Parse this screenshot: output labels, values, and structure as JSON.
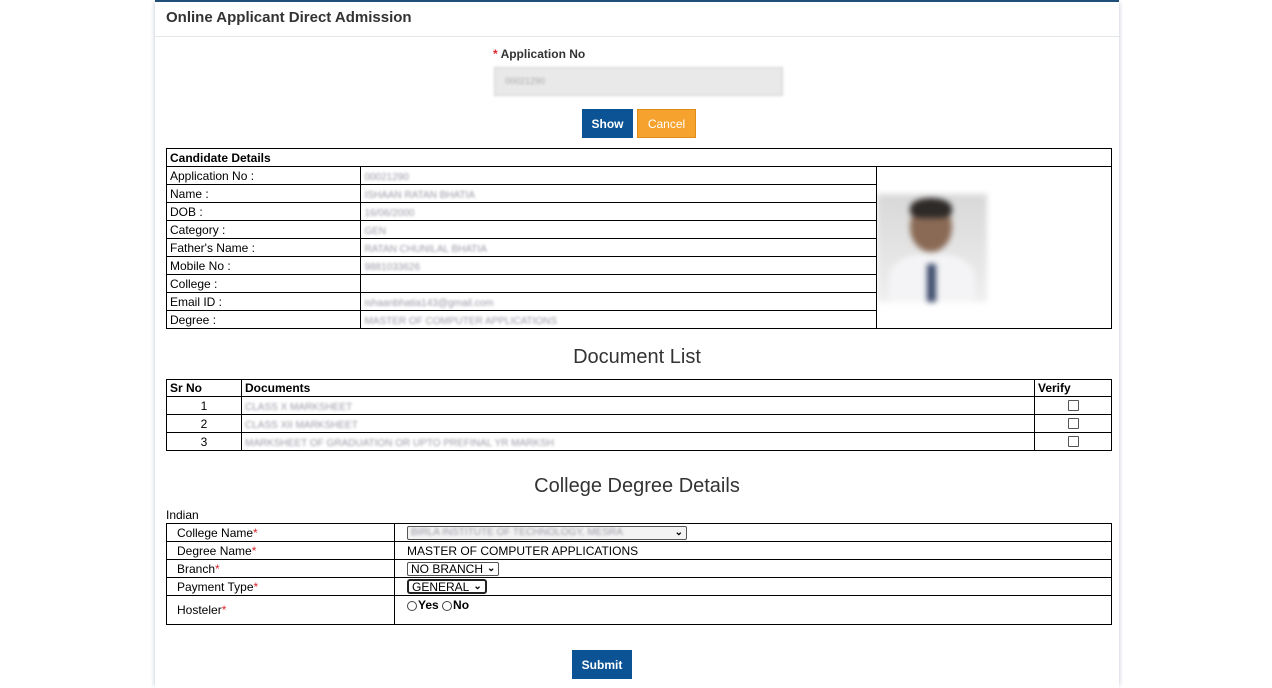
{
  "panel": {
    "title": "Online Applicant Direct Admission"
  },
  "search": {
    "label": "Application No",
    "required_mark": "*",
    "value": "00021290",
    "show_label": "Show",
    "cancel_label": "Cancel"
  },
  "candidate": {
    "heading": "Candidate Details",
    "rows": [
      {
        "label": "Application No :",
        "value": "00021290"
      },
      {
        "label": "Name :",
        "value": "ISHAAN RATAN BHATIA"
      },
      {
        "label": "DOB :",
        "value": "16/06/2000"
      },
      {
        "label": "Category :",
        "value": "GEN"
      },
      {
        "label": "Father's Name :",
        "value": "RATAN CHUNILAL BHATIA"
      },
      {
        "label": "Mobile No :",
        "value": "9881033626"
      },
      {
        "label": "College :",
        "value": ""
      },
      {
        "label": "Email ID :",
        "value": "ishaanbhatia143@gmail.com"
      },
      {
        "label": "Degree :",
        "value": "MASTER OF COMPUTER APPLICATIONS"
      }
    ]
  },
  "documents": {
    "title": "Document List",
    "headers": {
      "sr": "Sr No",
      "doc": "Documents",
      "verify": "Verify"
    },
    "rows": [
      {
        "sr": "1",
        "doc": "CLASS X MARKSHEET"
      },
      {
        "sr": "2",
        "doc": "CLASS XII MARKSHEET"
      },
      {
        "sr": "3",
        "doc": "MARKSHEET OF GRADUATION OR UPTO PREFINAL YR MARKSH"
      }
    ]
  },
  "degree": {
    "title": "College Degree Details",
    "nationality": "Indian",
    "required_mark": "*",
    "college_label": "College Name",
    "college_value": "BIRLA INSTITUTE OF TECHNOLOGY, MESRA",
    "degree_label": "Degree Name",
    "degree_value": "MASTER OF COMPUTER APPLICATIONS",
    "branch_label": "Branch",
    "branch_value": "NO BRANCH",
    "payment_label": "Payment Type",
    "payment_value": "GENERAL",
    "hosteler_label": "Hosteler",
    "hosteler_yes": "Yes",
    "hosteler_no": "No"
  },
  "submit_label": "Submit",
  "colors": {
    "primary": "#0b5394",
    "cancel": "#f6a22e",
    "required": "#d9272e"
  }
}
